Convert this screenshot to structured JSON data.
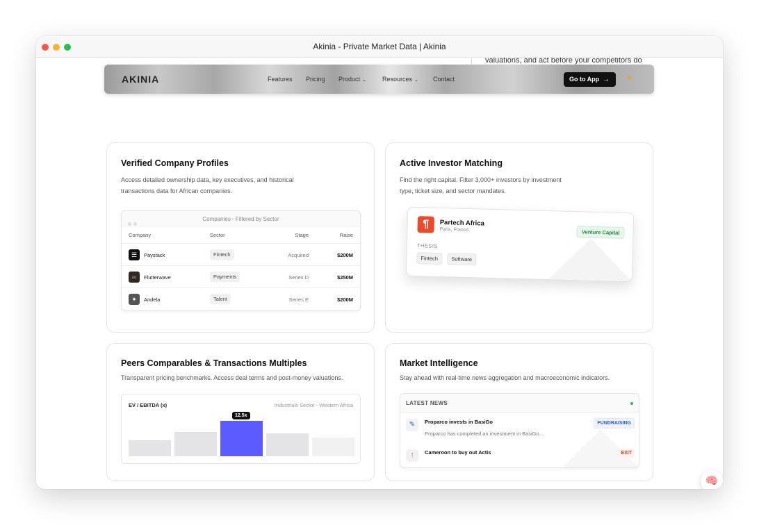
{
  "window": {
    "title": "Akinia - Private Market Data | Akinia"
  },
  "hero": {
    "fragment": "valuations, and act before your competitors do"
  },
  "nav": {
    "logo": "AKINIA",
    "links": [
      "Features",
      "Pricing",
      "Product",
      "Resources",
      "Contact"
    ],
    "cta": "Go to App"
  },
  "cards": {
    "profiles": {
      "title": "Verified Company Profiles",
      "desc": "Access detailed ownership data, key executives, and historical transactions data for African companies.",
      "table": {
        "title": "Companies - Filtered by Sector",
        "columns": [
          "Company",
          "Sector",
          "Stage",
          "Raise"
        ],
        "rows": [
          {
            "company": "Paystack",
            "sector": "Fintech",
            "stage": "Acquired",
            "raise": "$200M"
          },
          {
            "company": "Flutterwave",
            "sector": "Payments",
            "stage": "Series D",
            "raise": "$250M"
          },
          {
            "company": "Andela",
            "sector": "Talent",
            "stage": "Series E",
            "raise": "$200M"
          }
        ]
      }
    },
    "investor": {
      "title": "Active Investor Matching",
      "desc": "Find the right capital. Filter 3,000+ investors by investment type, ticket size, and sector mandates.",
      "investor_card": {
        "name": "Partech Africa",
        "location": "Paris, France",
        "badge": "Venture Capital",
        "thesis_label": "THESIS",
        "tags": [
          "Fintech",
          "Software"
        ]
      }
    },
    "peers": {
      "title": "Peers Comparables & Transactions Multiples",
      "desc": "Transparent pricing benchmarks. Access deal terms and post-money valuations.",
      "chart": {
        "label": "EV / EBITDA (x)",
        "sector": "Industrials Sector - Western Africa",
        "highlight_label": "12.5x",
        "bars": [
          0.3,
          0.45,
          0.65,
          0.42,
          0.35
        ],
        "highlight_index": 2
      }
    },
    "market": {
      "title": "Market Intelligence",
      "desc": "Stay ahead with real-time news aggregation and macroeconomic indicators.",
      "news": {
        "header": "LATEST NEWS",
        "items": [
          {
            "title": "Proparco invests in BasiGo",
            "sub": "Proparco has completed an investment in BasiGo...",
            "badge": "FUNDRAISING",
            "icon": "pen-icon"
          },
          {
            "title": "Cameroon to buy out Actis",
            "sub": "",
            "badge": "EXIT",
            "icon": "arrow-up-icon"
          }
        ]
      }
    }
  },
  "colors": {
    "accent": "#5b5bff",
    "green": "#1e8b46",
    "blue": "#2c5bd8",
    "red": "#d9411e"
  }
}
